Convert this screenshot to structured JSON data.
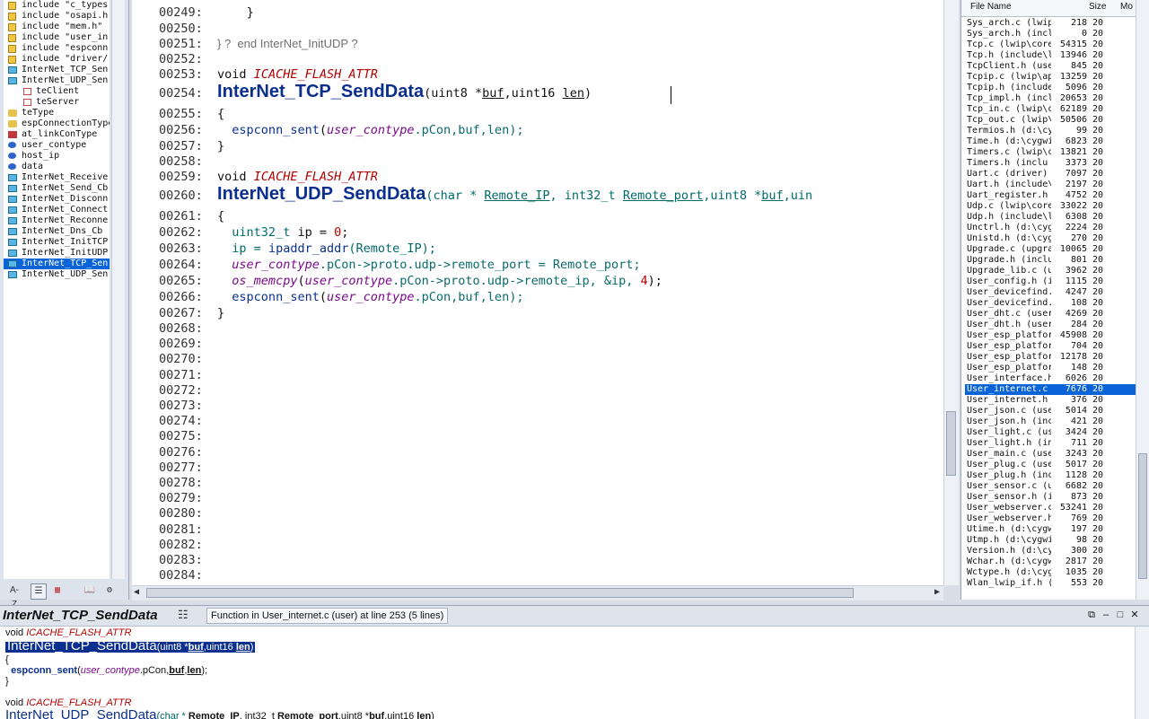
{
  "symbols": [
    {
      "icon": "include-icon",
      "label": "include \"c_types.",
      "indent": false
    },
    {
      "icon": "include-icon",
      "label": "include \"osapi.h\"",
      "indent": false
    },
    {
      "icon": "include-icon",
      "label": "include \"mem.h\"",
      "indent": false
    },
    {
      "icon": "include-icon",
      "label": "include \"user_in",
      "indent": false
    },
    {
      "icon": "include-icon",
      "label": "include \"espconn",
      "indent": false
    },
    {
      "icon": "include-icon",
      "label": "include \"driver/",
      "indent": false
    },
    {
      "icon": "function-icon",
      "label": "InterNet_TCP_Sen",
      "indent": false
    },
    {
      "icon": "function-icon",
      "label": "InterNet_UDP_Sen",
      "indent": false
    },
    {
      "icon": "field-icon",
      "label": "teClient",
      "indent": true
    },
    {
      "icon": "field-icon",
      "label": "teServer",
      "indent": true
    },
    {
      "icon": "type-icon",
      "label": "teType",
      "indent": false
    },
    {
      "icon": "type-icon",
      "label": "espConnectionType",
      "indent": false
    },
    {
      "icon": "enum-icon",
      "label": "at_linkConType",
      "indent": false
    },
    {
      "icon": "variable-icon",
      "label": "user_contype",
      "indent": false
    },
    {
      "icon": "variable-icon",
      "label": "host_ip",
      "indent": false
    },
    {
      "icon": "variable-icon",
      "label": "data",
      "indent": false
    },
    {
      "icon": "function-icon",
      "label": "InterNet_Receive",
      "indent": false
    },
    {
      "icon": "function-icon",
      "label": "InterNet_Send_Cb",
      "indent": false
    },
    {
      "icon": "function-icon",
      "label": "InterNet_Disconn",
      "indent": false
    },
    {
      "icon": "function-icon",
      "label": "InterNet_Connect",
      "indent": false
    },
    {
      "icon": "function-icon",
      "label": "InterNet_Reconne",
      "indent": false
    },
    {
      "icon": "function-icon",
      "label": "InterNet_Dns_Cb",
      "indent": false
    },
    {
      "icon": "function-icon",
      "label": "InterNet_InitTCP",
      "indent": false
    },
    {
      "icon": "function-icon",
      "label": "InterNet_InitUDP",
      "indent": false
    },
    {
      "icon": "function-icon",
      "label": "InterNet_TCP_Sen",
      "indent": false,
      "selected": true
    },
    {
      "icon": "function-icon",
      "label": "InterNet_UDP_Sen",
      "indent": false
    }
  ],
  "toolbar": {
    "az": "A-Z"
  },
  "editor": {
    "l249": "00249:",
    "l249b": "}",
    "l250": "00250:",
    "l251": "00251:",
    "l251c": "} ?  end InterNet_InitUDP ?",
    "l252": "00252:",
    "l253": "00253:",
    "void": "void",
    "attr": "ICACHE_FLASH_ATTR",
    "l254": "00254:",
    "tcp_fn": "InterNet_TCP_SendData",
    "tcp_p1": "(uint8 *",
    "buf": "buf",
    "tcp_p2": ",uint16 ",
    "len": "len",
    "tcp_p3": ")",
    "l255": "00255:",
    "lbrace": "{",
    "l256": "00256:",
    "espconn_sent": "espconn_sent",
    "paren_open": "(",
    "user_contype": "user_contype",
    "pcon_args": ".pCon,buf,len);",
    "l257": "00257:",
    "rbrace": "}",
    "l258": "00258:",
    "l259": "00259:",
    "l260": "00260:",
    "udp_fn": "InterNet_UDP_SendData",
    "udp_p1": "(char * ",
    "remote_ip": "Remote_IP",
    "udp_p2": ", int32_t ",
    "remote_port": "Remote_port",
    "udp_p3": ",uint8 *",
    "udp_p4": ",uin",
    "l261": "00261:",
    "l262": "00262:",
    "uint32_t": "uint32_t",
    "ip_decl": " ip = ",
    "zero": "0",
    "semicolon": ";",
    "l263": "00263:",
    "ip_assign": "ip = ",
    "ipaddr_addr": "ipaddr_addr",
    "remote_ip_call": "(Remote_IP);",
    "l264": "00264:",
    "proto_chain": ".pCon->proto.udp->remote_port = Remote_port;",
    "l265": "00265:",
    "os_memcpy": "os_memcpy",
    "memcpy_args": ".pCon->proto.udp->remote_ip, &ip, ",
    "four": "4",
    "close_semi": ");",
    "l266": "00266:",
    "l267": "00267:",
    "empty_lines": [
      "00268:",
      "00269:",
      "00270:",
      "00271:",
      "00272:",
      "00273:",
      "00274:",
      "00275:",
      "00276:",
      "00277:",
      "00278:",
      "00279:",
      "00280:",
      "00281:",
      "00282:",
      "00283:",
      "00284:"
    ]
  },
  "files": {
    "headers": {
      "name": "File Name",
      "size": "Size",
      "mod": "Mo"
    },
    "rows": [
      {
        "name": "Sys_arch.c (lwip",
        "size": "218",
        "mod": "20"
      },
      {
        "name": "Sys_arch.h (incl",
        "size": "0",
        "mod": "20"
      },
      {
        "name": "Tcp.c (lwip\\core",
        "size": "54315",
        "mod": "20"
      },
      {
        "name": "Tcp.h (include\\l",
        "size": "13946",
        "mod": "20"
      },
      {
        "name": "TcpClient.h (use",
        "size": "845",
        "mod": "20"
      },
      {
        "name": "Tcpip.c (lwip\\ap",
        "size": "13259",
        "mod": "20"
      },
      {
        "name": "Tcpip.h (include",
        "size": "5096",
        "mod": "20"
      },
      {
        "name": "Tcp_impl.h (incl",
        "size": "20653",
        "mod": "20"
      },
      {
        "name": "Tcp_in.c (lwip\\c",
        "size": "62189",
        "mod": "20"
      },
      {
        "name": "Tcp_out.c (lwip\\",
        "size": "50506",
        "mod": "20"
      },
      {
        "name": "Termios.h (d:\\cy",
        "size": "99",
        "mod": "20"
      },
      {
        "name": "Time.h (d:\\cygwi",
        "size": "6823",
        "mod": "20"
      },
      {
        "name": "Timers.c (lwip\\c",
        "size": "13821",
        "mod": "20"
      },
      {
        "name": "Timers.h (inclu",
        "size": "3373",
        "mod": "20"
      },
      {
        "name": "Uart.c (driver)",
        "size": "7097",
        "mod": "20"
      },
      {
        "name": "Uart.h (include\\",
        "size": "2197",
        "mod": "20"
      },
      {
        "name": "Uart_register.h",
        "size": "4752",
        "mod": "20"
      },
      {
        "name": "Udp.c (lwip\\core",
        "size": "33022",
        "mod": "20"
      },
      {
        "name": "Udp.h (include\\l",
        "size": "6308",
        "mod": "20"
      },
      {
        "name": "Unctrl.h (d:\\cyg",
        "size": "2224",
        "mod": "20"
      },
      {
        "name": "Unistd.h (d:\\cyg",
        "size": "270",
        "mod": "20"
      },
      {
        "name": "Upgrade.c (upgra",
        "size": "10065",
        "mod": "20"
      },
      {
        "name": "Upgrade.h (inclu",
        "size": "801",
        "mod": "20"
      },
      {
        "name": "Upgrade_lib.c (u",
        "size": "3962",
        "mod": "20"
      },
      {
        "name": "User_config.h (i",
        "size": "1115",
        "mod": "20"
      },
      {
        "name": "User_devicefind.",
        "size": "4247",
        "mod": "20"
      },
      {
        "name": "User_devicefind.",
        "size": "108",
        "mod": "20"
      },
      {
        "name": "User_dht.c (user",
        "size": "4269",
        "mod": "20"
      },
      {
        "name": "User_dht.h (user",
        "size": "284",
        "mod": "20"
      },
      {
        "name": "User_esp_platfor",
        "size": "45908",
        "mod": "20"
      },
      {
        "name": "User_esp_platfor",
        "size": "704",
        "mod": "20"
      },
      {
        "name": "User_esp_platfor",
        "size": "12178",
        "mod": "20"
      },
      {
        "name": "User_esp_platfor",
        "size": "148",
        "mod": "20"
      },
      {
        "name": "User_interface.h",
        "size": "6026",
        "mod": "20"
      },
      {
        "name": "User_internet.c",
        "size": "7676",
        "mod": "20",
        "selected": true
      },
      {
        "name": "User_internet.h",
        "size": "376",
        "mod": "20"
      },
      {
        "name": "User_json.c (use",
        "size": "5014",
        "mod": "20"
      },
      {
        "name": "User_json.h (inc",
        "size": "421",
        "mod": "20"
      },
      {
        "name": "User_light.c (us",
        "size": "3424",
        "mod": "20"
      },
      {
        "name": "User_light.h (in",
        "size": "711",
        "mod": "20"
      },
      {
        "name": "User_main.c (use",
        "size": "3243",
        "mod": "20"
      },
      {
        "name": "User_plug.c (use",
        "size": "5017",
        "mod": "20"
      },
      {
        "name": "User_plug.h (inc",
        "size": "1128",
        "mod": "20"
      },
      {
        "name": "User_sensor.c (u",
        "size": "6682",
        "mod": "20"
      },
      {
        "name": "User_sensor.h (i",
        "size": "873",
        "mod": "20"
      },
      {
        "name": "User_webserver.c",
        "size": "53241",
        "mod": "20"
      },
      {
        "name": "User_webserver.h",
        "size": "769",
        "mod": "20"
      },
      {
        "name": "Utime.h (d:\\cygw",
        "size": "197",
        "mod": "20"
      },
      {
        "name": "Utmp.h (d:\\cygwi",
        "size": "98",
        "mod": "20"
      },
      {
        "name": "Version.h (d:\\cy",
        "size": "300",
        "mod": "20"
      },
      {
        "name": "Wchar.h (d:\\cygw",
        "size": "2817",
        "mod": "20"
      },
      {
        "name": "Wctype.h (d:\\cyg",
        "size": "1035",
        "mod": "20"
      },
      {
        "name": "Wlan_lwip_if.h (",
        "size": "553",
        "mod": "20"
      }
    ]
  },
  "context": {
    "symbol": "InterNet_TCP_SendData",
    "description": "Function in User_internet.c (user) at line 253 (5 lines)",
    "void": "void ",
    "attr": "ICACHE_FLASH_ATTR",
    "tcp_fn": "InterNet_TCP_SendData",
    "tcp_a": "(uint8 *",
    "buf": "buf",
    "tcp_b": ",uint16 ",
    "len": "len",
    "tcp_c": ")",
    "lbrace": "{",
    "call": "espconn_sent",
    "call_open": "(",
    "user_contype": "user_contype",
    "call_rest": ".pCon,",
    "comma": ",",
    "close": ");",
    "rbrace": "}",
    "udp_fn": "InterNet_UDP_SendData",
    "udp_a": "(char * ",
    "remote_ip": "Remote_IP",
    "udp_b": ", int32_t ",
    "remote_port": "Remote_port",
    "udp_c": ",uint8 *",
    "udp_d": ",uint16 ",
    "udp_e": ")"
  }
}
